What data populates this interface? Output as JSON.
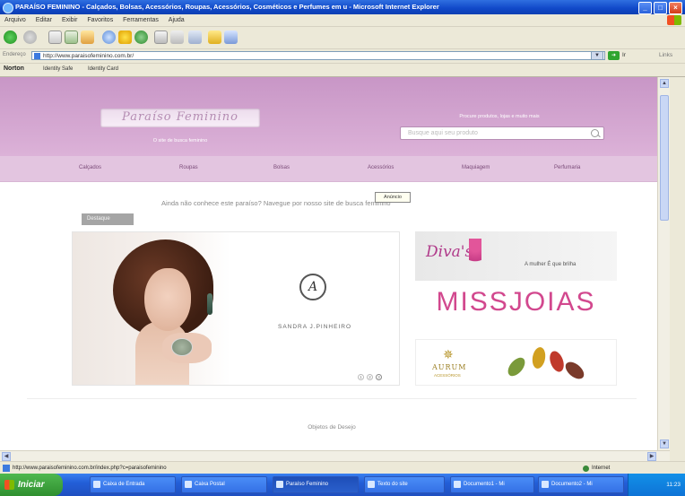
{
  "window": {
    "title": "PARAÍSO FEMININO - Calçados, Bolsas, Acessórios, Roupas, Acessórios, Cosméticos e Perfumes em u - Microsoft Internet Explorer",
    "minimize_label": "_",
    "maximize_label": "□",
    "close_label": "×"
  },
  "menu": [
    "Arquivo",
    "Editar",
    "Exibir",
    "Favoritos",
    "Ferramentas",
    "Ajuda"
  ],
  "address_bar": {
    "label": "Endereço",
    "url": "http://www.paraisofeminino.com.br/",
    "go_label": "Ir",
    "links_label": "Links"
  },
  "links_bar": {
    "norton": "Norton",
    "items": [
      "Identity Safe",
      "Identity Card"
    ]
  },
  "site": {
    "logo_text": "Paraíso Feminino",
    "tagline": "O site de busca feminino",
    "search_title": "Procure produtos, lojas e muito mais",
    "search_placeholder": "Busque aqui seu produto",
    "nav": [
      "Calçados",
      "Roupas",
      "Bolsas",
      "Acessórios",
      "Maquiagem",
      "Perfumaria"
    ],
    "tooltip": "Anúncio",
    "welcome": "Ainda não conhece este paraíso? Navegue por nosso site de busca feminino",
    "gray_tab": "Destaque",
    "slider": {
      "brand_name": "SANDRA J.PINHEIRO",
      "brand_monogram": "A",
      "pages": [
        "1",
        "2",
        "3"
      ]
    },
    "ads": {
      "dior_script": "Diva's",
      "dior_sub": "A mulher É que brilha",
      "miss": "MISSJOIAS",
      "aurum_name": "AURUM",
      "aurum_sub": "ACESSÓRIOS"
    },
    "section_title": "Objetos de Desejo"
  },
  "status": {
    "url": "http://www.paraisofeminino.com.br/index.php?c=paraisofeminino",
    "zone": "Internet"
  },
  "taskbar": {
    "start": "Iniciar",
    "tasks": [
      "Caixa de Entrada",
      "Caixa Postal",
      "Paraíso Feminino",
      "Texto do site",
      "Documento1 - Mi",
      "Documento2 - Mi"
    ],
    "clock": "11:23"
  },
  "colors": {
    "header_pink": "#c896c6",
    "nav_pink": "#e3c5e0",
    "miss_pink": "#d2488e",
    "xp_blue": "#235fd8"
  }
}
